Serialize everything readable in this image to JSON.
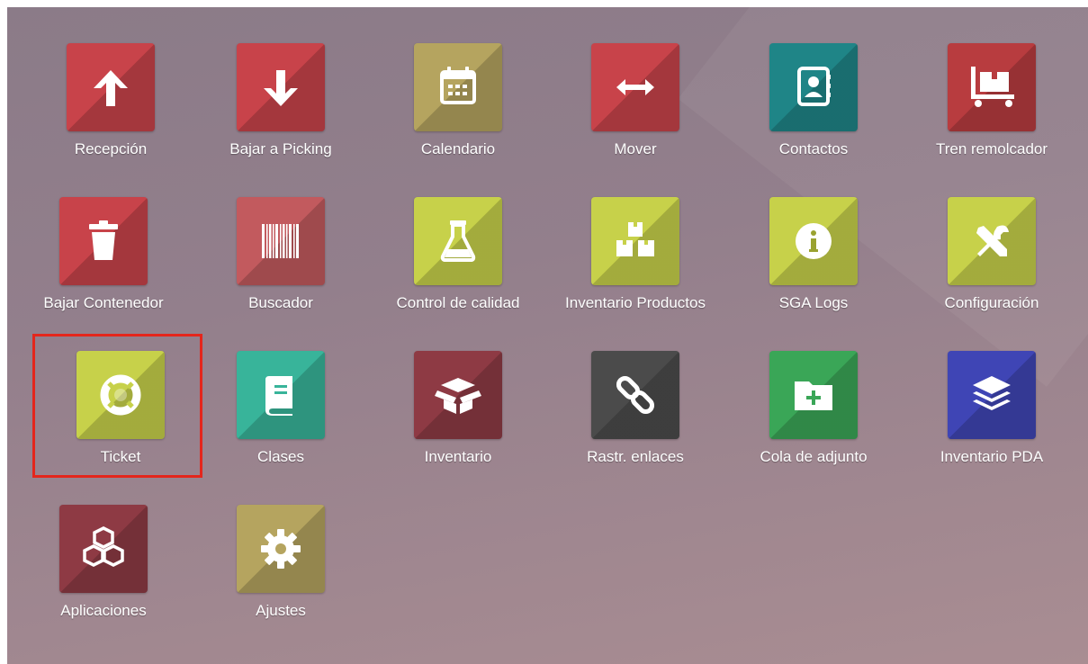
{
  "apps": [
    {
      "label": "Recepción",
      "icon": "arrow-up-icon",
      "color": "#c8434a"
    },
    {
      "label": "Bajar a Picking",
      "icon": "arrow-down-icon",
      "color": "#c8434a"
    },
    {
      "label": "Calendario",
      "icon": "calendar-icon",
      "color": "#b5a45f"
    },
    {
      "label": "Mover",
      "icon": "arrows-horizontal-icon",
      "color": "#c8434a"
    },
    {
      "label": "Contactos",
      "icon": "address-book-icon",
      "color": "#1f8587"
    },
    {
      "label": "Tren remolcador",
      "icon": "pallet-truck-icon",
      "color": "#b83c3f"
    },
    {
      "label": "Bajar Contenedor",
      "icon": "trash-icon",
      "color": "#c8434a"
    },
    {
      "label": "Buscador",
      "icon": "barcode-icon",
      "color": "#c25a5e"
    },
    {
      "label": "Control de calidad",
      "icon": "flask-icon",
      "color": "#c7d14a"
    },
    {
      "label": "Inventario Productos",
      "icon": "boxes-icon",
      "color": "#c7d14a"
    },
    {
      "label": "SGA Logs",
      "icon": "info-icon",
      "color": "#c7d14a"
    },
    {
      "label": "Configuración",
      "icon": "tools-icon",
      "color": "#c7d14a"
    },
    {
      "label": "Ticket",
      "icon": "life-ring-icon",
      "color": "#c7d14a"
    },
    {
      "label": "Clases",
      "icon": "book-icon",
      "color": "#38b49a"
    },
    {
      "label": "Inventario",
      "icon": "open-box-icon",
      "color": "#8e3a44"
    },
    {
      "label": "Rastr. enlaces",
      "icon": "link-icon",
      "color": "#4b4b4b"
    },
    {
      "label": "Cola de adjunto",
      "icon": "folder-plus-icon",
      "color": "#3aa657"
    },
    {
      "label": "Inventario PDA",
      "icon": "layers-icon",
      "color": "#3f45b5"
    },
    {
      "label": "Aplicaciones",
      "icon": "cubes-icon",
      "color": "#8e3a44"
    },
    {
      "label": "Ajustes",
      "icon": "gear-icon",
      "color": "#b5a45f"
    }
  ],
  "highlighted_app": "Ticket"
}
